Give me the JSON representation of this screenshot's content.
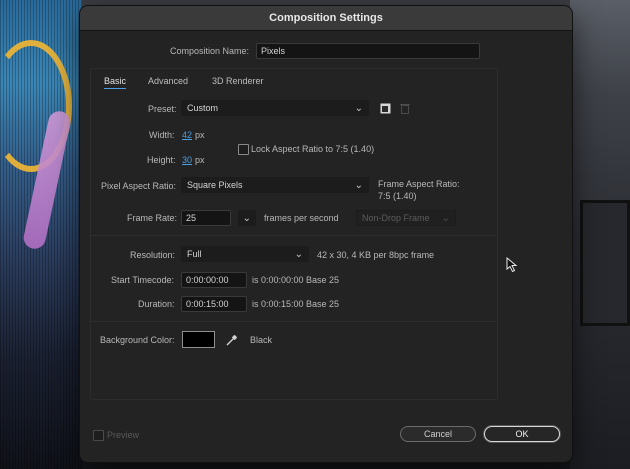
{
  "dialog": {
    "title": "Composition Settings"
  },
  "composition_name": {
    "label": "Composition Name:",
    "value": "Pixels"
  },
  "tabs": [
    {
      "label": "Basic",
      "active": true
    },
    {
      "label": "Advanced",
      "active": false
    },
    {
      "label": "3D Renderer",
      "active": false
    }
  ],
  "preset": {
    "label": "Preset:",
    "value": "Custom",
    "save_icon": "save-preset-icon",
    "delete_icon": "trash-icon"
  },
  "width": {
    "label": "Width:",
    "value": "42",
    "unit": "px"
  },
  "height": {
    "label": "Height:",
    "value": "30",
    "unit": "px"
  },
  "lock_aspect": {
    "label": "Lock Aspect Ratio to 7:5 (1.40)",
    "checked": false
  },
  "pixel_aspect": {
    "label": "Pixel Aspect Ratio:",
    "value": "Square Pixels"
  },
  "frame_aspect": {
    "label": "Frame Aspect Ratio:",
    "value": "7:5 (1.40)"
  },
  "frame_rate": {
    "label": "Frame Rate:",
    "value": "25",
    "unit_label": "frames per second",
    "drop_frame": "Non-Drop Frame"
  },
  "resolution": {
    "label": "Resolution:",
    "value": "Full",
    "info": "42 x 30, 4 KB per 8bpc frame"
  },
  "start_timecode": {
    "label": "Start Timecode:",
    "value": "0:00:00:00",
    "info": "is 0:00:00:00  Base 25"
  },
  "duration": {
    "label": "Duration:",
    "value": "0:00:15:00",
    "info": "is 0:00:15:00  Base 25"
  },
  "background_color": {
    "label": "Background Color:",
    "color": "#000000",
    "name": "Black",
    "eyedropper_icon": "eyedropper-icon"
  },
  "footer": {
    "preview_label": "Preview",
    "cancel_label": "Cancel",
    "ok_label": "OK"
  },
  "colors": {
    "accent": "#4b9fe4",
    "dialog_bg": "#232323",
    "titlebar_bg": "#3a3a3a"
  }
}
